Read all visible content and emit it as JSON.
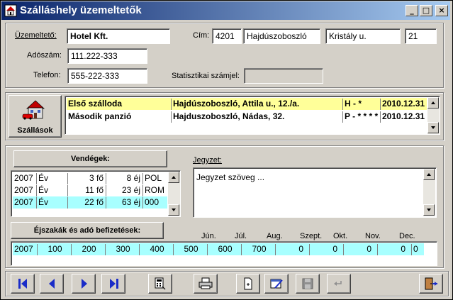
{
  "window": {
    "title": "Szálláshely üzemeltetők"
  },
  "operator": {
    "label": "Üzemeltető:",
    "name": "Hotel Kft.",
    "address_label": "Cím:",
    "zip": "4201",
    "city": "Hajdúszoboszló",
    "street": "Kristály u.",
    "number": "21",
    "tax_label": "Adószám:",
    "tax_id": "111.222-333",
    "phone_label": "Telefon:",
    "phone": "555-222-333",
    "stat_label": "Statisztikai számjel:",
    "stat_id": ""
  },
  "lodgings": {
    "button_label": "Szállások",
    "rows": [
      {
        "name": "Első szálloda",
        "address": "Hajdúszoboszló, Attila u., 12./a.",
        "category": "H - *",
        "date": "2010.12.31"
      },
      {
        "name": "Második panzió",
        "address": "Hajduszoboszló, Nádas, 32.",
        "category": "P - * * * *",
        "date": "2010.12.31"
      }
    ]
  },
  "guests": {
    "button_label": "Vendégek:",
    "rows": [
      {
        "year": "2007",
        "unit": "Év",
        "persons": "3 fő",
        "nights": "8 éj",
        "country": "POL"
      },
      {
        "year": "2007",
        "unit": "Év",
        "persons": "11 fő",
        "nights": "23 éj",
        "country": "ROM"
      },
      {
        "year": "2007",
        "unit": "Év",
        "persons": "22 fő",
        "nights": "63 éj",
        "country": "000"
      }
    ]
  },
  "note": {
    "label": "Jegyzet:",
    "text": "Jegyzet szöveg ..."
  },
  "nights": {
    "button_label": "Éjszakák és adó befizetések:",
    "months": [
      "Jún.",
      "Júl.",
      "Aug.",
      "Szept.",
      "Okt.",
      "Nov.",
      "Dec."
    ],
    "row": [
      "2007",
      "100",
      "200",
      "300",
      "400",
      "500",
      "600",
      "700",
      "0",
      "0",
      "0",
      "0",
      "0"
    ]
  },
  "colors": {
    "selected_yellow": "#ffff99",
    "selected_cyan": "#a8ffff",
    "nav_blue": "#1a2cc8"
  }
}
